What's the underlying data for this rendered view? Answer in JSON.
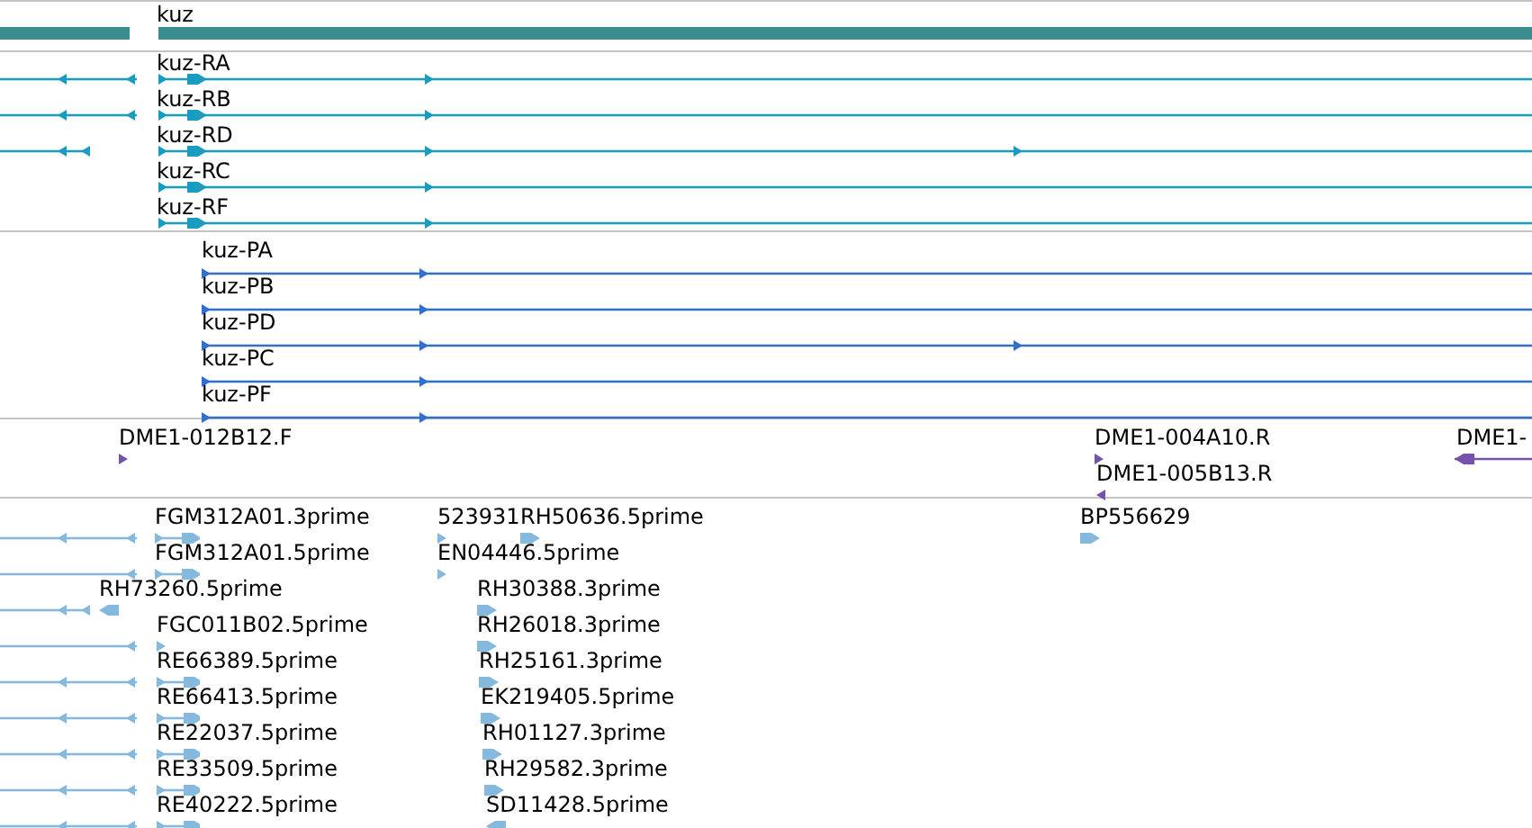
{
  "tracks": [
    {
      "kind": "gene",
      "rows": [
        {
          "features": [
            {
              "label": "kuz"
            }
          ]
        }
      ]
    },
    {
      "kind": "mrna",
      "rows": [
        {
          "features": [
            {
              "label": "kuz-RA"
            }
          ]
        },
        {
          "features": [
            {
              "label": "kuz-RB"
            }
          ]
        },
        {
          "features": [
            {
              "label": "kuz-RD"
            }
          ]
        },
        {
          "features": [
            {
              "label": "kuz-RC"
            }
          ]
        },
        {
          "features": [
            {
              "label": "kuz-RF"
            }
          ]
        }
      ]
    },
    {
      "kind": "protein",
      "rows": [
        {
          "features": [
            {
              "label": "kuz-PA"
            }
          ]
        },
        {
          "features": [
            {
              "label": "kuz-PB"
            }
          ]
        },
        {
          "features": [
            {
              "label": "kuz-PD"
            }
          ]
        },
        {
          "features": [
            {
              "label": "kuz-PC"
            }
          ]
        },
        {
          "features": [
            {
              "label": "kuz-PF"
            }
          ]
        }
      ]
    },
    {
      "kind": "clone",
      "rows": [
        {
          "features": [
            {
              "label": "DME1-012B12.F"
            },
            {
              "label": "DME1-004A10.R"
            },
            {
              "label": "DME1-"
            }
          ]
        },
        {
          "features": [
            {
              "label": "DME1-005B13.R"
            }
          ]
        }
      ]
    },
    {
      "kind": "est",
      "rows": [
        {
          "features": [
            {
              "label": "FGM312A01.3prime"
            },
            {
              "label": "523931"
            },
            {
              "label": "RH50636.5prime"
            },
            {
              "label": "BP556629"
            }
          ]
        },
        {
          "features": [
            {
              "label": "FGM312A01.5prime"
            },
            {
              "label": "EN04446.5prime"
            }
          ]
        },
        {
          "features": [
            {
              "label": "RH73260.5prime"
            },
            {
              "label": "RH30388.3prime"
            }
          ]
        },
        {
          "features": [
            {
              "label": "FGC011B02.5prime"
            },
            {
              "label": "RH26018.3prime"
            }
          ]
        },
        {
          "features": [
            {
              "label": "RE66389.5prime"
            },
            {
              "label": "RH25161.3prime"
            }
          ]
        },
        {
          "features": [
            {
              "label": "RE66413.5prime"
            },
            {
              "label": "EK219405.5prime"
            }
          ]
        },
        {
          "features": [
            {
              "label": "RE22037.5prime"
            },
            {
              "label": "RH01127.3prime"
            }
          ]
        },
        {
          "features": [
            {
              "label": "RE33509.5prime"
            },
            {
              "label": "RH29582.3prime"
            }
          ]
        },
        {
          "features": [
            {
              "label": "RE40222.5prime"
            },
            {
              "label": "SD11428.5prime"
            }
          ]
        }
      ]
    }
  ]
}
